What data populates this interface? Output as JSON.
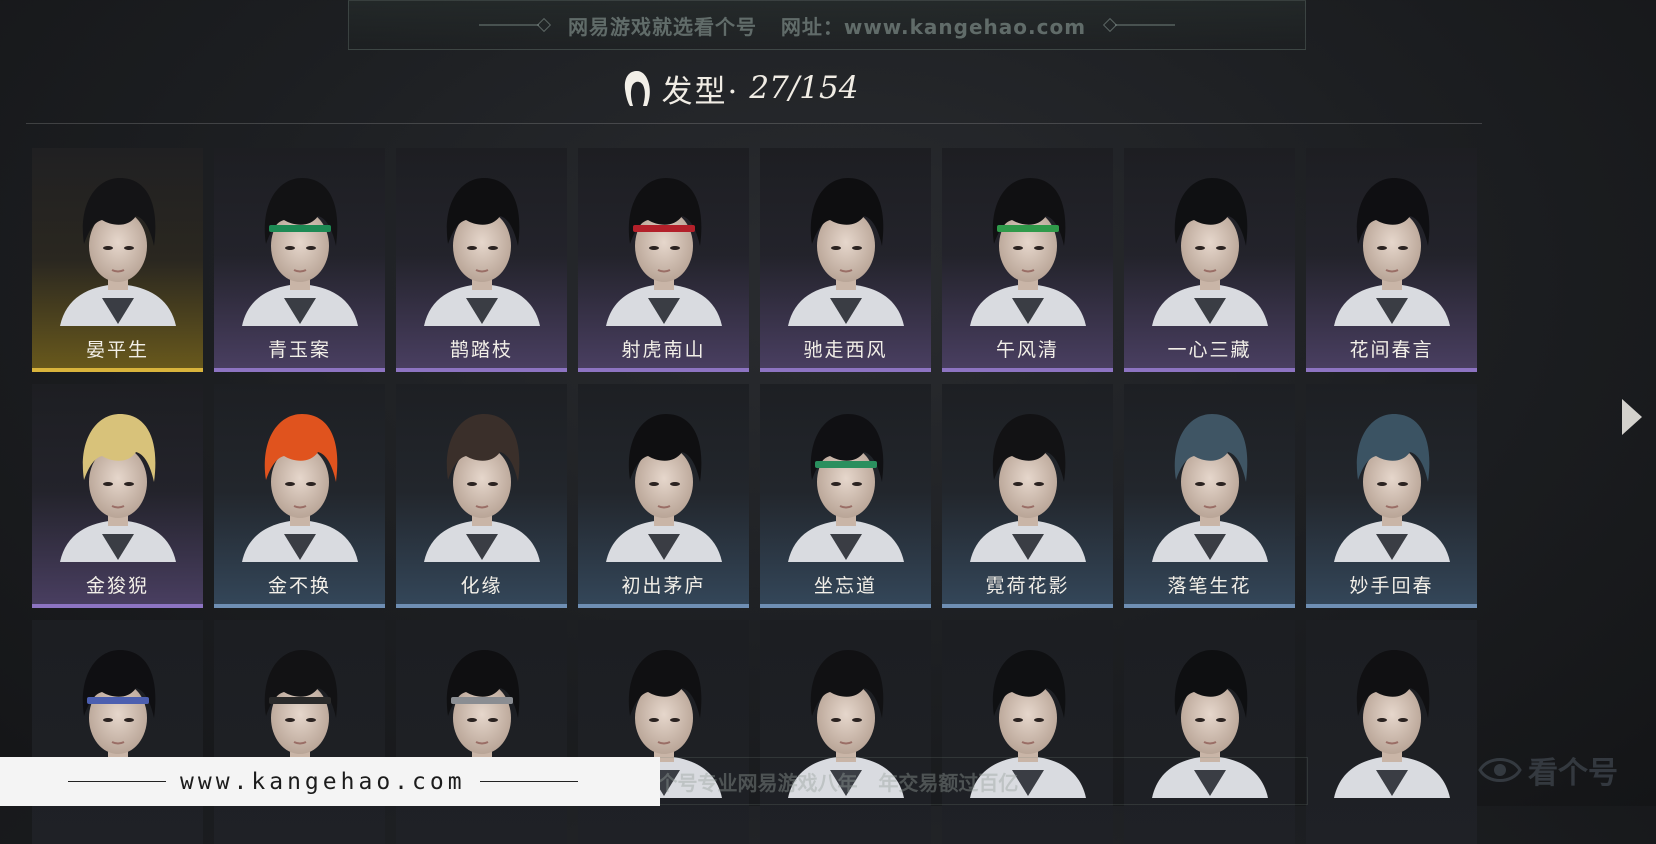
{
  "banner": {
    "text": "网易游戏就选看个号   网址：www.kangehao.com"
  },
  "header": {
    "title": "发型·",
    "count": "27/154",
    "icon": "hair-icon"
  },
  "hairstyles": [
    {
      "name": "晏平生",
      "rarity": "legend",
      "hair": "#141416",
      "band": null
    },
    {
      "name": "青玉案",
      "rarity": "epic",
      "hair": "#121214",
      "band": "#1d8a54"
    },
    {
      "name": "鹊踏枝",
      "rarity": "epic",
      "hair": "#0f0f11",
      "band": null
    },
    {
      "name": "射虎南山",
      "rarity": "epic",
      "hair": "#101012",
      "band": "#b3202a"
    },
    {
      "name": "驰走西风",
      "rarity": "epic",
      "hair": "#0e0e10",
      "band": null
    },
    {
      "name": "午风清",
      "rarity": "epic",
      "hair": "#101012",
      "band": "#2f9a4a"
    },
    {
      "name": "一心三藏",
      "rarity": "epic",
      "hair": "#0f1012",
      "band": null
    },
    {
      "name": "花间春言",
      "rarity": "epic",
      "hair": "#0f0f12",
      "band": null
    },
    {
      "name": "金狻猊",
      "rarity": "epic",
      "hair": "#d8c27a",
      "band": null
    },
    {
      "name": "金不换",
      "rarity": "rare",
      "hair": "#e0531e",
      "band": null
    },
    {
      "name": "化缘",
      "rarity": "rare",
      "hair": "#3a2f2a",
      "band": null
    },
    {
      "name": "初出茅庐",
      "rarity": "rare",
      "hair": "#0f0f11",
      "band": null
    },
    {
      "name": "坐忘道",
      "rarity": "rare",
      "hair": "#101013",
      "band": "#2a8f5e"
    },
    {
      "name": "霓荷花影",
      "rarity": "rare",
      "hair": "#121214",
      "band": null
    },
    {
      "name": "落笔生花",
      "rarity": "rare",
      "hair": "#3f5564",
      "band": null
    },
    {
      "name": "妙手回春",
      "rarity": "rare",
      "hair": "#3b5363",
      "band": null
    },
    {
      "name": "",
      "rarity": "plain",
      "hair": "#0f0f12",
      "band": "#4c5fb0"
    },
    {
      "name": "",
      "rarity": "plain",
      "hair": "#121214",
      "band": "#2a2a2a"
    },
    {
      "name": "",
      "rarity": "plain",
      "hair": "#0f0f11",
      "band": "#8a8d92"
    },
    {
      "name": "",
      "rarity": "plain",
      "hair": "#101012",
      "band": null
    },
    {
      "name": "",
      "rarity": "plain",
      "hair": "#111113",
      "band": null
    },
    {
      "name": "",
      "rarity": "plain",
      "hair": "#0f1012",
      "band": null
    },
    {
      "name": "",
      "rarity": "plain",
      "hair": "#0e0f11",
      "band": null
    },
    {
      "name": "",
      "rarity": "plain",
      "hair": "#101012",
      "band": null
    }
  ],
  "nav": {
    "next_icon": "chevron-right-icon"
  },
  "footer": {
    "url": "www.kangehao.com",
    "watermark": "看个号专业网易游戏八年   年交易额过百亿",
    "logo_text": "看个号"
  }
}
